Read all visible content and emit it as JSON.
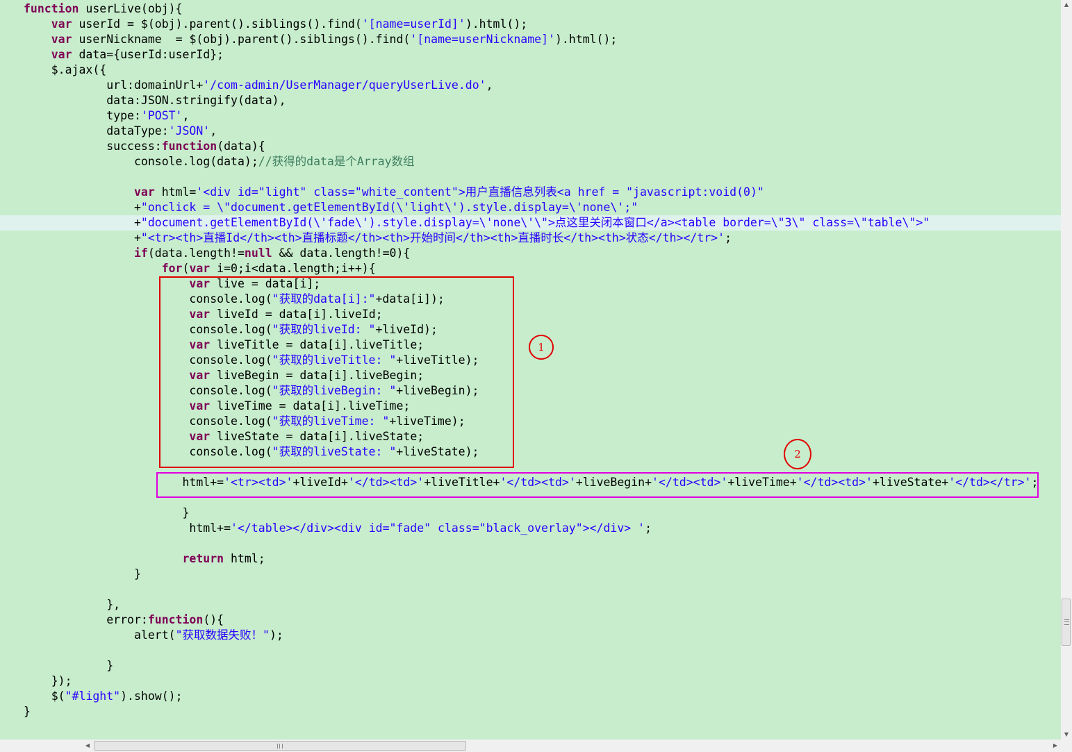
{
  "code_lines": [
    {
      "indent": "",
      "tokens": [
        {
          "t": "kw",
          "v": "function"
        },
        {
          "t": "p",
          "v": " userLive(obj){"
        }
      ]
    },
    {
      "indent": "    ",
      "tokens": [
        {
          "t": "kw",
          "v": "var"
        },
        {
          "t": "p",
          "v": " userId = $(obj).parent().siblings().find("
        },
        {
          "t": "str",
          "v": "'[name=userId]'"
        },
        {
          "t": "p",
          "v": ").html();"
        }
      ]
    },
    {
      "indent": "    ",
      "tokens": [
        {
          "t": "kw",
          "v": "var"
        },
        {
          "t": "p",
          "v": " userNickname  = $(obj).parent().siblings().find("
        },
        {
          "t": "str",
          "v": "'[name=userNickname]'"
        },
        {
          "t": "p",
          "v": ").html();"
        }
      ]
    },
    {
      "indent": "    ",
      "tokens": [
        {
          "t": "kw",
          "v": "var"
        },
        {
          "t": "p",
          "v": " data={userId:userId};"
        }
      ]
    },
    {
      "indent": "    ",
      "tokens": [
        {
          "t": "p",
          "v": "$.ajax({"
        }
      ]
    },
    {
      "indent": "            ",
      "tokens": [
        {
          "t": "p",
          "v": "url:domainUrl+"
        },
        {
          "t": "str",
          "v": "'/com-admin/UserManager/queryUserLive.do'"
        },
        {
          "t": "p",
          "v": ","
        }
      ]
    },
    {
      "indent": "            ",
      "tokens": [
        {
          "t": "p",
          "v": "data:JSON.stringify(data),"
        }
      ]
    },
    {
      "indent": "            ",
      "tokens": [
        {
          "t": "p",
          "v": "type:"
        },
        {
          "t": "str",
          "v": "'POST'"
        },
        {
          "t": "p",
          "v": ","
        }
      ]
    },
    {
      "indent": "            ",
      "tokens": [
        {
          "t": "p",
          "v": "dataType:"
        },
        {
          "t": "str",
          "v": "'JSON'"
        },
        {
          "t": "p",
          "v": ","
        }
      ]
    },
    {
      "indent": "            ",
      "tokens": [
        {
          "t": "p",
          "v": "success:"
        },
        {
          "t": "kw",
          "v": "function"
        },
        {
          "t": "p",
          "v": "(data){"
        }
      ]
    },
    {
      "indent": "                ",
      "tokens": [
        {
          "t": "p",
          "v": "console.log(data);"
        },
        {
          "t": "cmt",
          "v": "//获得的data是个Array数组"
        }
      ]
    },
    {
      "indent": "",
      "tokens": []
    },
    {
      "indent": "                ",
      "tokens": [
        {
          "t": "kw",
          "v": "var"
        },
        {
          "t": "p",
          "v": " html="
        },
        {
          "t": "str",
          "v": "'<div id=\"light\" class=\"white_content\">用户直播信息列表<a href = \"javascript:void(0)\""
        }
      ]
    },
    {
      "indent": "                ",
      "tokens": [
        {
          "t": "p",
          "v": "+"
        },
        {
          "t": "str",
          "v": "\"onclick = \\\"document.getElementById(\\'light\\').style.display=\\'none\\';\""
        }
      ]
    },
    {
      "indent": "                ",
      "current": true,
      "tokens": [
        {
          "t": "p",
          "v": "+"
        },
        {
          "t": "str",
          "v": "\"document.getElementById(\\'fade\\').style.display=\\'none\\'\\\">点这里关闭本窗口</a><table border=\\\"3\\\" class=\\\"table\\\">\""
        }
      ]
    },
    {
      "indent": "                ",
      "tokens": [
        {
          "t": "p",
          "v": "+"
        },
        {
          "t": "str",
          "v": "\"<tr><th>直播Id</th><th>直播标题</th><th>开始时间</th><th>直播时长</th><th>状态</th></tr>'"
        },
        {
          "t": "p",
          "v": ";"
        }
      ]
    },
    {
      "indent": "                ",
      "tokens": [
        {
          "t": "kw",
          "v": "if"
        },
        {
          "t": "p",
          "v": "(data.length!="
        },
        {
          "t": "kw",
          "v": "null"
        },
        {
          "t": "p",
          "v": " && data.length!=0){"
        }
      ]
    },
    {
      "indent": "                    ",
      "tokens": [
        {
          "t": "kw",
          "v": "for"
        },
        {
          "t": "p",
          "v": "("
        },
        {
          "t": "kw",
          "v": "var"
        },
        {
          "t": "p",
          "v": " i=0;i<data.length;i++){"
        }
      ]
    },
    {
      "indent": "                        ",
      "tokens": [
        {
          "t": "kw",
          "v": "var"
        },
        {
          "t": "p",
          "v": " live = data[i];"
        }
      ]
    },
    {
      "indent": "                        ",
      "tokens": [
        {
          "t": "p",
          "v": "console.log("
        },
        {
          "t": "str",
          "v": "\"获取的data[i]:\""
        },
        {
          "t": "p",
          "v": "+data[i]);"
        }
      ]
    },
    {
      "indent": "                        ",
      "tokens": [
        {
          "t": "kw",
          "v": "var"
        },
        {
          "t": "p",
          "v": " liveId = data[i].liveId;"
        }
      ]
    },
    {
      "indent": "                        ",
      "tokens": [
        {
          "t": "p",
          "v": "console.log("
        },
        {
          "t": "str",
          "v": "\"获取的liveId: \""
        },
        {
          "t": "p",
          "v": "+liveId);"
        }
      ]
    },
    {
      "indent": "                        ",
      "tokens": [
        {
          "t": "kw",
          "v": "var"
        },
        {
          "t": "p",
          "v": " liveTitle = data[i].liveTitle;"
        }
      ]
    },
    {
      "indent": "                        ",
      "tokens": [
        {
          "t": "p",
          "v": "console.log("
        },
        {
          "t": "str",
          "v": "\"获取的liveTitle: \""
        },
        {
          "t": "p",
          "v": "+liveTitle);"
        }
      ]
    },
    {
      "indent": "                        ",
      "tokens": [
        {
          "t": "kw",
          "v": "var"
        },
        {
          "t": "p",
          "v": " liveBegin = data[i].liveBegin;"
        }
      ]
    },
    {
      "indent": "                        ",
      "tokens": [
        {
          "t": "p",
          "v": "console.log("
        },
        {
          "t": "str",
          "v": "\"获取的liveBegin: \""
        },
        {
          "t": "p",
          "v": "+liveBegin);"
        }
      ]
    },
    {
      "indent": "                        ",
      "tokens": [
        {
          "t": "kw",
          "v": "var"
        },
        {
          "t": "p",
          "v": " liveTime = data[i].liveTime;"
        }
      ]
    },
    {
      "indent": "                        ",
      "tokens": [
        {
          "t": "p",
          "v": "console.log("
        },
        {
          "t": "str",
          "v": "\"获取的liveTime: \""
        },
        {
          "t": "p",
          "v": "+liveTime);"
        }
      ]
    },
    {
      "indent": "                        ",
      "tokens": [
        {
          "t": "kw",
          "v": "var"
        },
        {
          "t": "p",
          "v": " liveState = data[i].liveState;"
        }
      ]
    },
    {
      "indent": "                        ",
      "tokens": [
        {
          "t": "p",
          "v": "console.log("
        },
        {
          "t": "str",
          "v": "\"获取的liveState: \""
        },
        {
          "t": "p",
          "v": "+liveState);"
        }
      ]
    },
    {
      "indent": "",
      "tokens": []
    },
    {
      "indent": "                       ",
      "tokens": [
        {
          "t": "p",
          "v": "html+="
        },
        {
          "t": "str",
          "v": "'<tr><td>'"
        },
        {
          "t": "p",
          "v": "+liveId+"
        },
        {
          "t": "str",
          "v": "'</td><td>'"
        },
        {
          "t": "p",
          "v": "+liveTitle+"
        },
        {
          "t": "str",
          "v": "'</td><td>'"
        },
        {
          "t": "p",
          "v": "+liveBegin+"
        },
        {
          "t": "str",
          "v": "'</td><td>'"
        },
        {
          "t": "p",
          "v": "+liveTime+"
        },
        {
          "t": "str",
          "v": "'</td><td>'"
        },
        {
          "t": "p",
          "v": "+liveState+"
        },
        {
          "t": "str",
          "v": "'</td></tr>'"
        },
        {
          "t": "p",
          "v": ";"
        }
      ]
    },
    {
      "indent": "",
      "tokens": []
    },
    {
      "indent": "                       ",
      "tokens": [
        {
          "t": "p",
          "v": "}"
        }
      ]
    },
    {
      "indent": "                        ",
      "tokens": [
        {
          "t": "p",
          "v": "html+="
        },
        {
          "t": "str",
          "v": "'</table></div><div id=\"fade\" class=\"black_overlay\"></div> '"
        },
        {
          "t": "p",
          "v": ";"
        }
      ]
    },
    {
      "indent": "",
      "tokens": []
    },
    {
      "indent": "                       ",
      "tokens": [
        {
          "t": "kw",
          "v": "return"
        },
        {
          "t": "p",
          "v": " html;"
        }
      ]
    },
    {
      "indent": "                ",
      "tokens": [
        {
          "t": "p",
          "v": "}"
        }
      ]
    },
    {
      "indent": "",
      "tokens": []
    },
    {
      "indent": "            ",
      "tokens": [
        {
          "t": "p",
          "v": "},"
        }
      ]
    },
    {
      "indent": "            ",
      "tokens": [
        {
          "t": "p",
          "v": "error:"
        },
        {
          "t": "kw",
          "v": "function"
        },
        {
          "t": "p",
          "v": "(){"
        }
      ]
    },
    {
      "indent": "                ",
      "tokens": [
        {
          "t": "p",
          "v": "alert("
        },
        {
          "t": "str",
          "v": "\"获取数据失败！\""
        },
        {
          "t": "p",
          "v": ");"
        }
      ]
    },
    {
      "indent": "",
      "tokens": []
    },
    {
      "indent": "            ",
      "tokens": [
        {
          "t": "p",
          "v": "}"
        }
      ]
    },
    {
      "indent": "    ",
      "tokens": [
        {
          "t": "p",
          "v": "});"
        }
      ]
    },
    {
      "indent": "    ",
      "tokens": [
        {
          "t": "p",
          "v": "$("
        },
        {
          "t": "str",
          "v": "\"#light\""
        },
        {
          "t": "p",
          "v": ").show();"
        }
      ]
    },
    {
      "indent": "",
      "tokens": [
        {
          "t": "p",
          "v": "}"
        }
      ]
    }
  ],
  "annotations": [
    {
      "label": "1",
      "color": "#e00000"
    },
    {
      "label": "2",
      "color": "#e00000"
    }
  ],
  "highlight_colors": {
    "box_1": "#e00000",
    "box_2": "#e000e0"
  },
  "theme": {
    "background": "#c7edcc",
    "keyword": "#7f0055",
    "string": "#2a00ff",
    "comment": "#3f7f5f",
    "current_line": "#dff2ee"
  },
  "scrollbars": {
    "vertical": {
      "up_icon": "▲",
      "down_icon": "▼"
    },
    "horizontal": {
      "left_icon": "◀",
      "right_icon": "▶"
    }
  }
}
